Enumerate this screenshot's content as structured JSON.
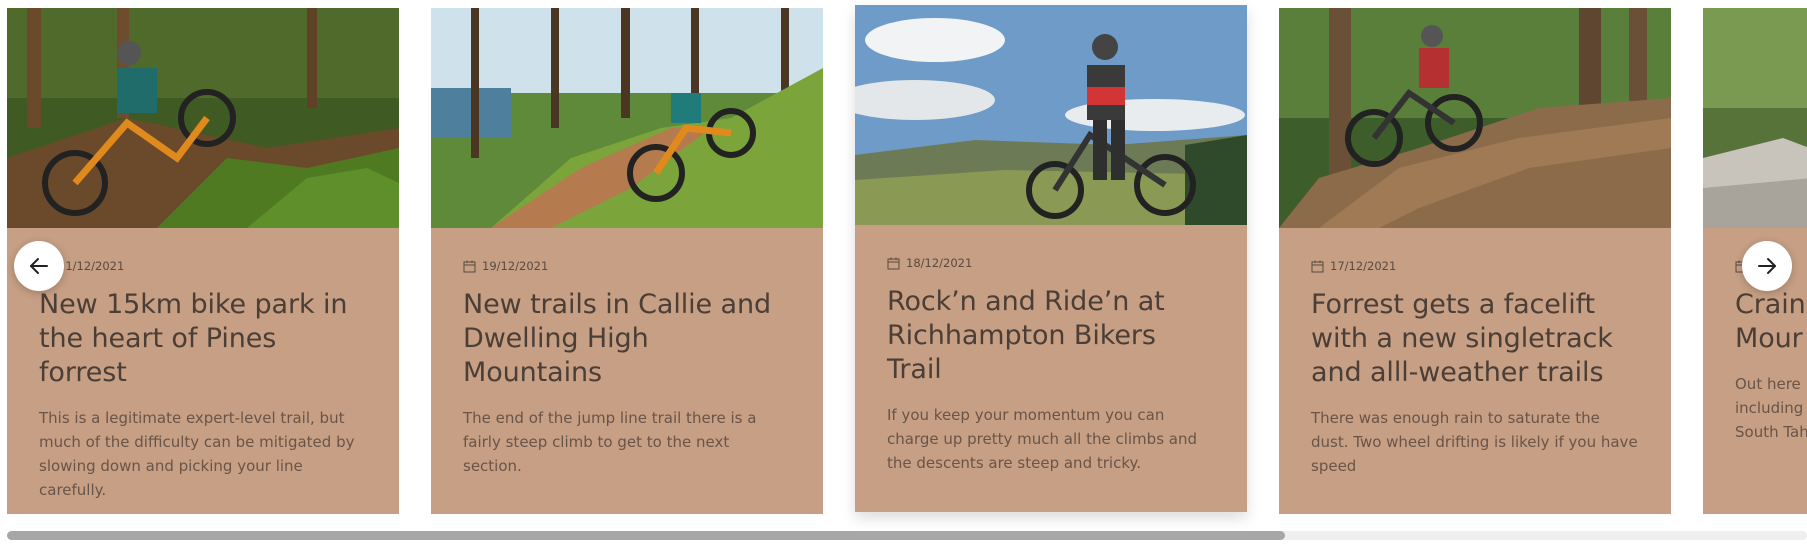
{
  "carousel": {
    "cards": [
      {
        "date": "21/12/2021",
        "title": "New 15km bike park in the heart of Pines forrest",
        "excerpt": "This is a legitimate expert-level trail, but much of the difficulty can be mitigated by slowing down and picking your line carefully."
      },
      {
        "date": "19/12/2021",
        "title": "New trails in Callie and Dwelling High Mountains",
        "excerpt": "The end of the jump line trail there is a fairly steep climb to get to the next section."
      },
      {
        "date": "18/12/2021",
        "title": "Rock’n and Ride’n at Richhampton Bikers Trail",
        "excerpt": "If you keep your momentum you can charge up pretty much all the climbs and the descents are steep and tricky."
      },
      {
        "date": "17/12/2021",
        "title": "Forrest gets a facelift with a new singletrack and alll-weather trails",
        "excerpt": "There was enough rain to saturate the dust. Two wheel drifting is likely if you have speed"
      },
      {
        "date": "",
        "title": "Crain Mour",
        "excerpt": "Out here including South Tah"
      }
    ],
    "prev_button": {
      "icon": "arrow-left-icon"
    },
    "next_button": {
      "icon": "arrow-right-icon"
    },
    "scroll_progress": 0.71
  },
  "colors": {
    "card_bg": "#c69f84",
    "title_text": "#4b3e37",
    "excerpt_text": "#6a5448",
    "scroll_thumb": "#a7a7a7",
    "scroll_track": "#efefef"
  }
}
